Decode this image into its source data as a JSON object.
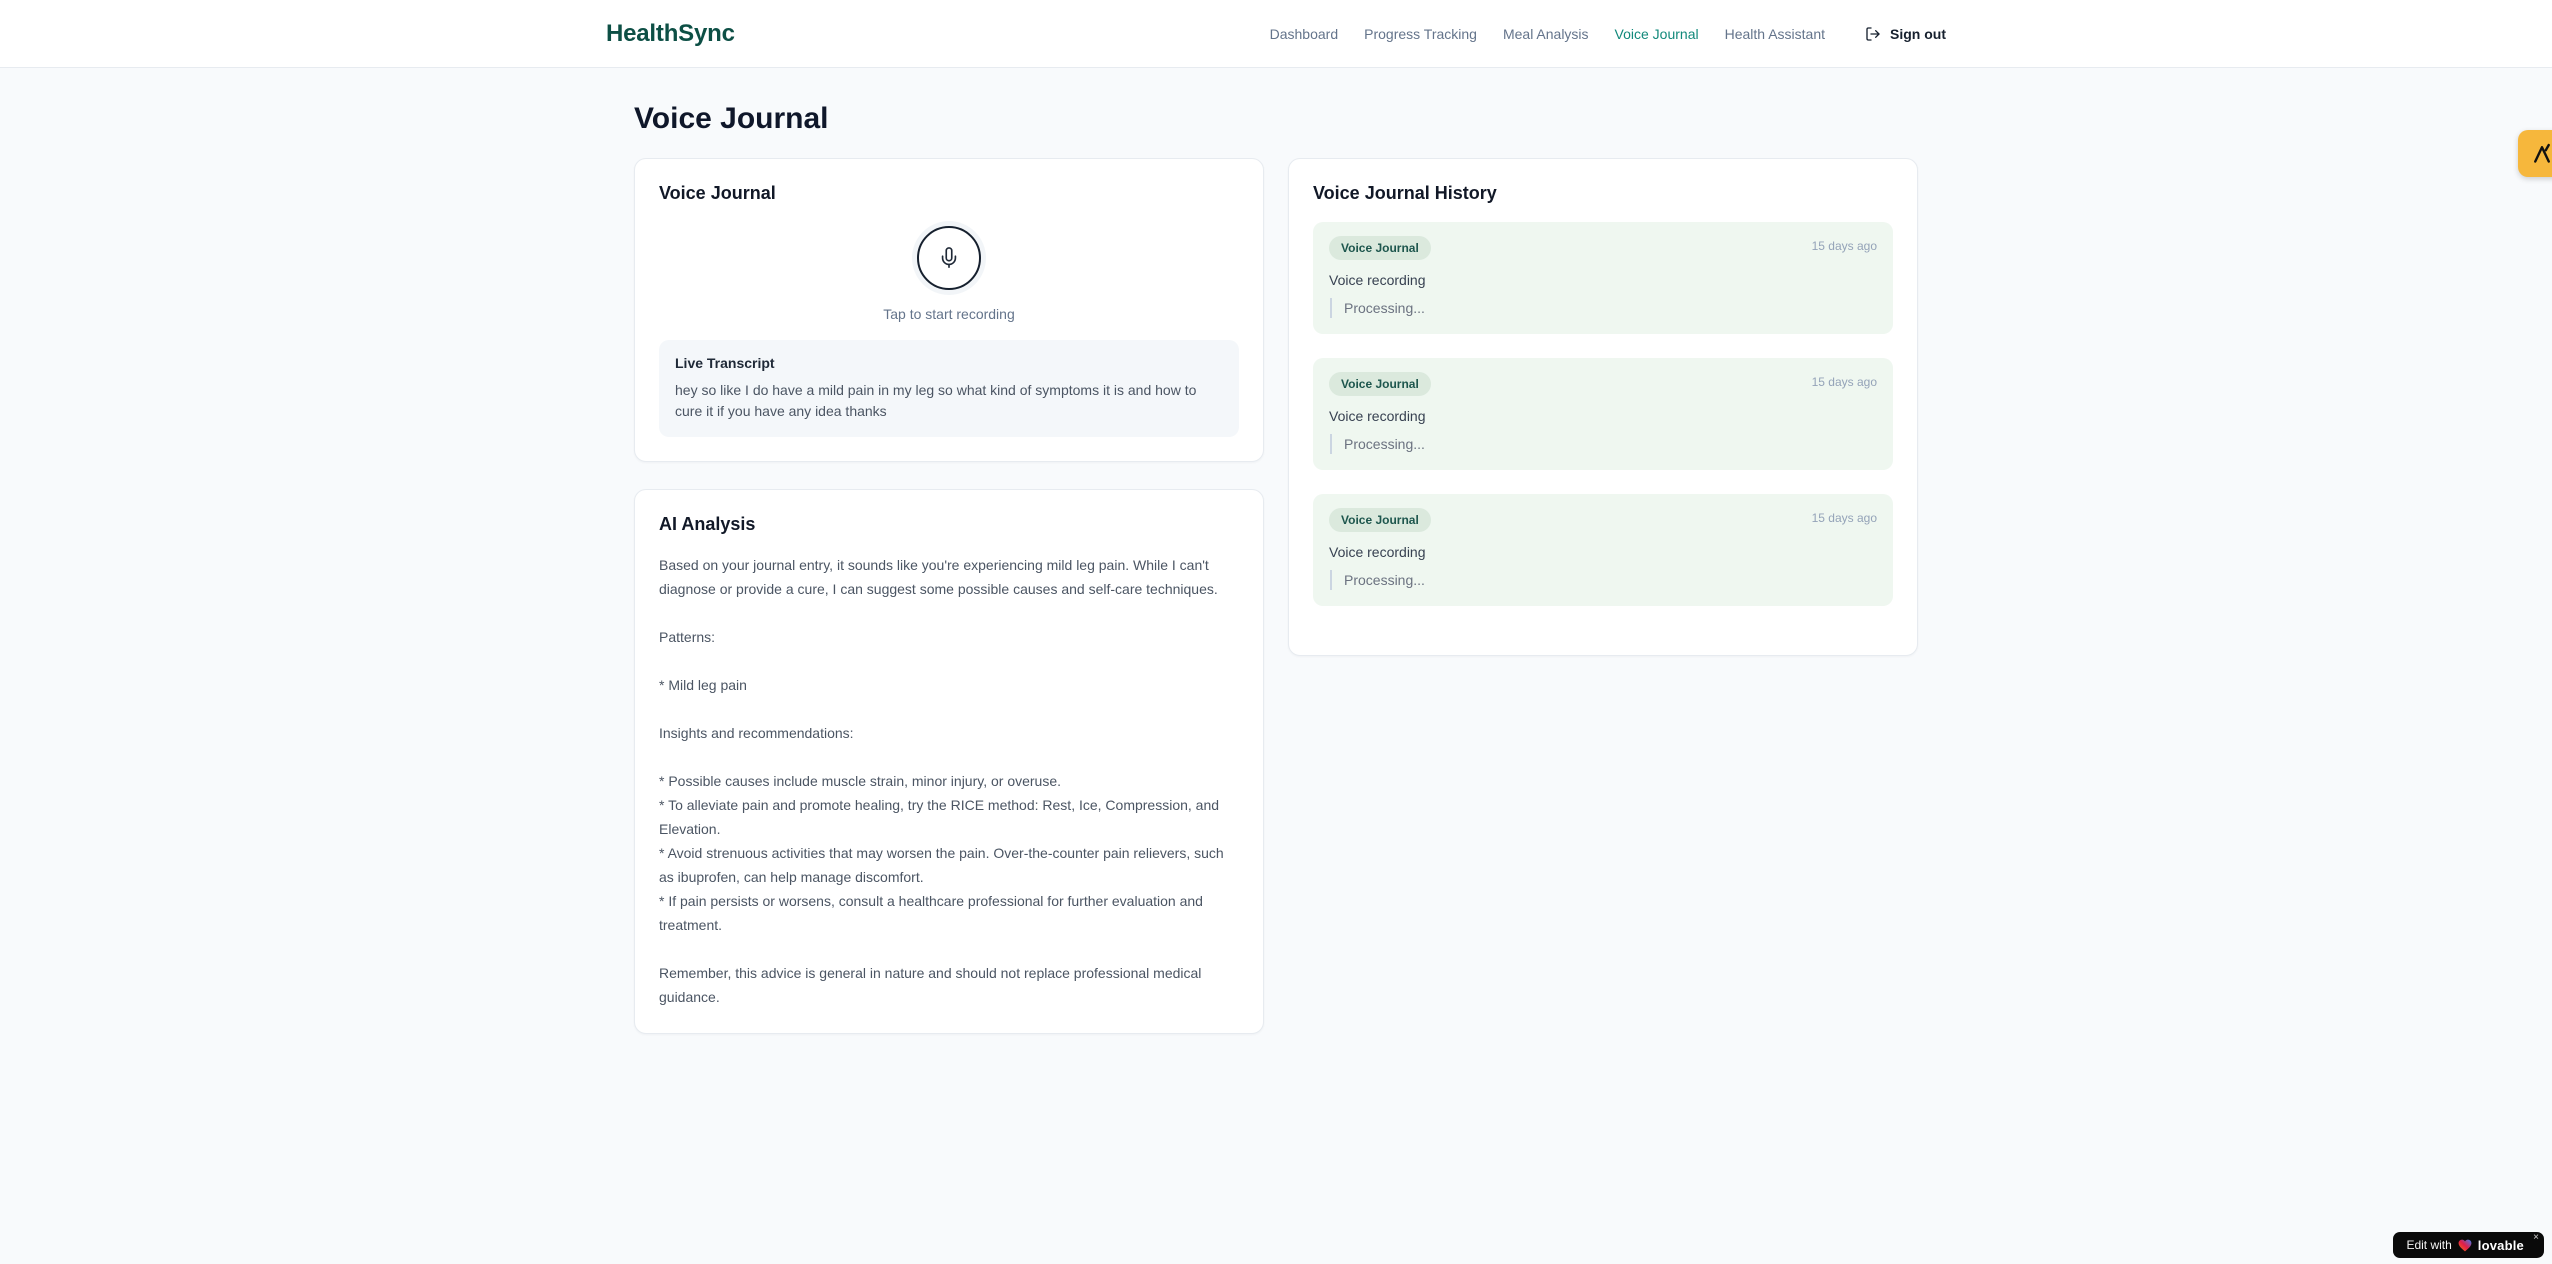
{
  "header": {
    "logo": "HealthSync",
    "nav": [
      {
        "label": "Dashboard",
        "active": false
      },
      {
        "label": "Progress Tracking",
        "active": false
      },
      {
        "label": "Meal Analysis",
        "active": false
      },
      {
        "label": "Voice Journal",
        "active": true
      },
      {
        "label": "Health Assistant",
        "active": false
      }
    ],
    "sign_out_label": "Sign out"
  },
  "page": {
    "title": "Voice Journal"
  },
  "recorder": {
    "card_title": "Voice Journal",
    "tap_hint": "Tap to start recording",
    "transcript_title": "Live Transcript",
    "transcript_text": "hey so like I do have a mild pain in my leg so what kind of symptoms it is and how to cure it if you have any idea thanks"
  },
  "analysis": {
    "card_title": "AI Analysis",
    "body": "Based on your journal entry, it sounds like you're experiencing mild leg pain. While I can't diagnose or provide a cure, I can suggest some possible causes and self-care techniques.\n\nPatterns:\n\n* Mild leg pain\n\nInsights and recommendations:\n\n* Possible causes include muscle strain, minor injury, or overuse.\n* To alleviate pain and promote healing, try the RICE method: Rest, Ice, Compression, and Elevation.\n* Avoid strenuous activities that may worsen the pain. Over-the-counter pain relievers, such as ibuprofen, can help manage discomfort.\n* If pain persists or worsens, consult a healthcare professional for further evaluation and treatment.\n\nRemember, this advice is general in nature and should not replace professional medical guidance."
  },
  "history": {
    "card_title": "Voice Journal History",
    "entries": [
      {
        "badge": "Voice Journal",
        "time": "15 days ago",
        "title": "Voice recording",
        "status": "Processing..."
      },
      {
        "badge": "Voice Journal",
        "time": "15 days ago",
        "title": "Voice recording",
        "status": "Processing..."
      },
      {
        "badge": "Voice Journal",
        "time": "15 days ago",
        "title": "Voice recording",
        "status": "Processing..."
      }
    ]
  },
  "floating": {
    "edit_prefix": "Edit with",
    "edit_brand": "lovable",
    "close_glyph": "×"
  },
  "icons": {
    "mic": "microphone-icon",
    "logout": "logout-icon",
    "heart": "gradient-heart-icon",
    "side_fab": "lovable-caret-icon"
  },
  "colors": {
    "brand_teal_dark": "#0d4f45",
    "nav_active_teal": "#12897b",
    "page_background": "#f8fafc",
    "history_entry_green": "#eff7f0",
    "badge_green_bg": "#dbe9dd",
    "badge_green_text": "#1d564d",
    "fab_amber": "#f6b73c",
    "edit_badge_black": "#0a0a0a"
  }
}
